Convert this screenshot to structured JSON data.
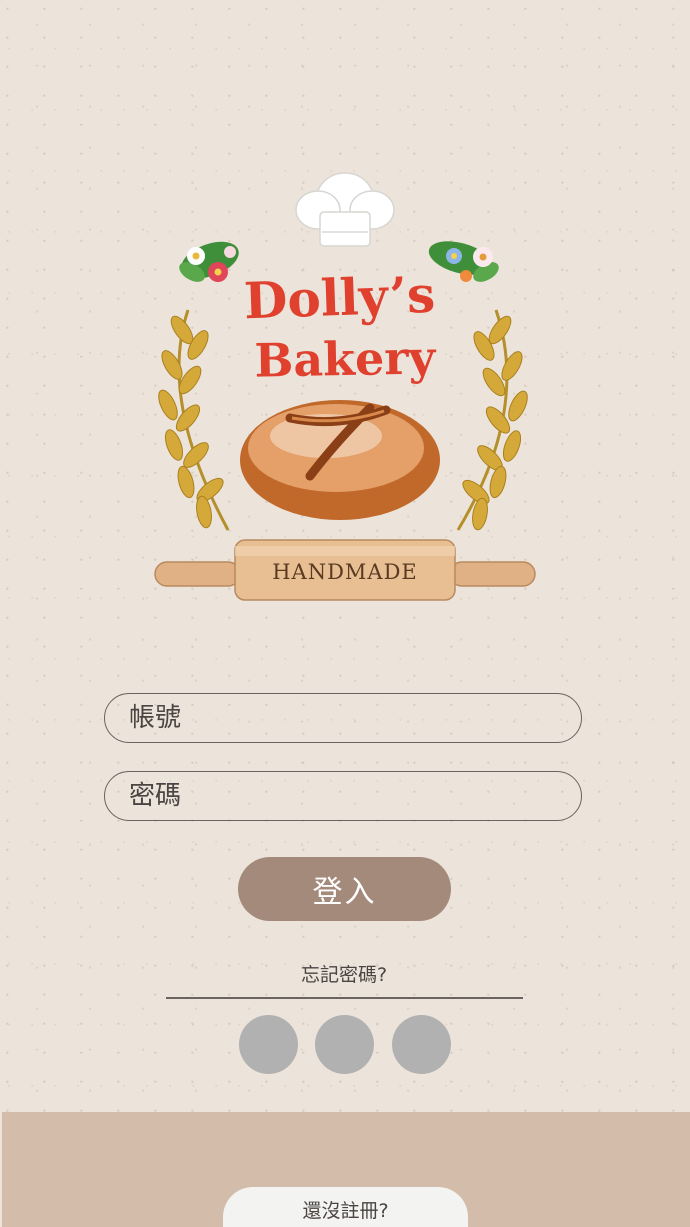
{
  "logo": {
    "brand_line1": "Dolly’s",
    "brand_line2": "Bakery",
    "pin_text": "HANDMADE"
  },
  "login_form": {
    "account_placeholder": "帳號",
    "password_placeholder": "密碼",
    "login_label": "登入",
    "forgot_label": "忘記密碼?"
  },
  "social_buttons": [
    "social-login-1",
    "social-login-2",
    "social-login-3"
  ],
  "footer": {
    "register_label": "還沒註冊?"
  },
  "colors": {
    "background": "#ece3da",
    "brand_red": "#e0402e",
    "button": "#a48a7b",
    "social": "#b1b1b1",
    "footer": "#d3bcaa",
    "register_tab": "#f3f3f1"
  }
}
